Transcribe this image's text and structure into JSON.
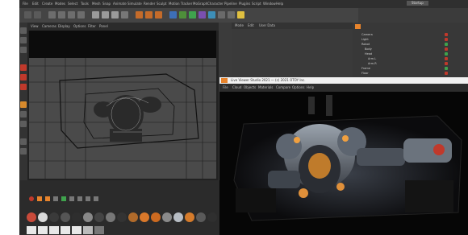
{
  "app": {
    "menu_items": [
      "File",
      "Edit",
      "Create",
      "Modes",
      "Select",
      "Tools",
      "Mesh",
      "Snap",
      "Animate",
      "Simulate",
      "Render",
      "Sculpt",
      "Motion Tracker",
      "MoGraph",
      "Character",
      "Pipeline",
      "Plugins",
      "Script",
      "Window",
      "Help"
    ],
    "layout_label": "Startup"
  },
  "viewport": {
    "menu": [
      "View",
      "Cameras",
      "Display",
      "Options",
      "Filter",
      "Panel"
    ]
  },
  "attributes": {
    "tabs": [
      "Mode",
      "Edit",
      "User Data"
    ]
  },
  "objects": {
    "rows": [
      "Camera",
      "Light",
      "Robot",
      "Body",
      "Head",
      "Arm.L",
      "Arm.R",
      "Frame",
      "Floor"
    ]
  },
  "render_window": {
    "title": "Live Viewer Studio 2021 — (c) 2021 OTOY Inc.",
    "menu": [
      "File",
      "Cloud",
      "Objects",
      "Materials",
      "Compare",
      "Options",
      "Help"
    ]
  },
  "colors": {
    "accent_orange": "#e8842c",
    "panel_dark": "#2b2b2b",
    "panel_mid": "#3b3b3b",
    "status_red": "#c0392b",
    "status_green": "#3fa34d"
  }
}
